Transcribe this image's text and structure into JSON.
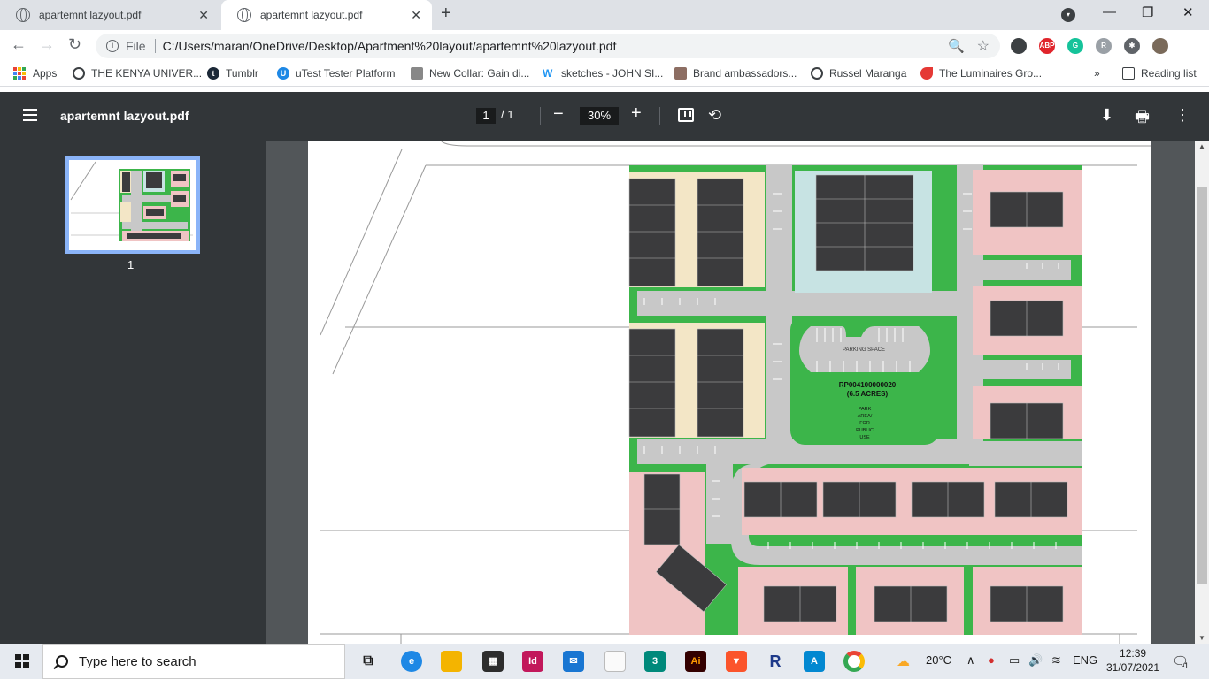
{
  "tabs": [
    {
      "title": "apartemnt lazyout.pdf",
      "active": false
    },
    {
      "title": "apartemnt lazyout.pdf",
      "active": true
    }
  ],
  "tab_close_glyph": "✕",
  "new_tab_glyph": "+",
  "window_controls": {
    "minimize": "—",
    "maximize": "❐",
    "close": "✕"
  },
  "toolbar": {
    "back_glyph": "←",
    "forward_glyph": "→",
    "reload_glyph": "↻",
    "file_label": "File",
    "url": "C:/Users/maran/OneDrive/Desktop/Apartment%20layout/apartemnt%20lazyout.pdf",
    "zoom_glyph": "🔍",
    "star_glyph": "☆"
  },
  "extensions": [
    {
      "name": "extension-icon",
      "label": "",
      "color": "#3c4043"
    },
    {
      "name": "adblock-icon",
      "label": "ABP",
      "color": "#e0242b"
    },
    {
      "name": "grammarly-icon",
      "label": "G",
      "color": "#15c39a"
    },
    {
      "name": "reader-extension-icon",
      "label": "R",
      "color": "#9aa0a6"
    },
    {
      "name": "puzzle-icon",
      "label": "✱",
      "color": "#5f6368"
    },
    {
      "name": "profile-avatar",
      "label": "",
      "color": "#7a6a5a"
    }
  ],
  "bookmarks": [
    {
      "label": "Apps",
      "icon": "apps-grid-icon",
      "color": "#ea4335"
    },
    {
      "label": "THE KENYA UNIVER...",
      "icon": "globe-icon",
      "color": "#3c4043"
    },
    {
      "label": "Tumblr",
      "icon": "tumblr-icon",
      "color": "#1b2837"
    },
    {
      "label": "uTest Tester Platform",
      "icon": "utest-icon",
      "color": "#1e88e5"
    },
    {
      "label": "New Collar: Gain di...",
      "icon": "newcollar-icon",
      "color": "#555555"
    },
    {
      "label": "sketches - JOHN SI...",
      "icon": "weebly-icon",
      "color": "#2196f3"
    },
    {
      "label": "Brand ambassadors...",
      "icon": "brand-icon",
      "color": "#8d6e63"
    },
    {
      "label": "Russel Maranga",
      "icon": "globe-icon",
      "color": "#3c4043"
    },
    {
      "label": "The Luminaires Gro...",
      "icon": "luminaires-icon",
      "color": "#e53935"
    }
  ],
  "bookmarks_overflow": "»",
  "reading_list": "Reading list",
  "pdf": {
    "title": "apartemnt lazyout.pdf",
    "page_current": "1",
    "page_total": "/  1",
    "zoom": "30%",
    "minus": "−",
    "plus": "+",
    "rotate_glyph": "⟲",
    "download_glyph": "⬇",
    "print_glyph": "🖶",
    "more_glyph": "⋮",
    "thumbnail_page": "1"
  },
  "plan": {
    "parking_label": "PARKING SPACE",
    "parcel_id": "RP004100000020",
    "acres": "(6.5 ACRES)",
    "park_lines": [
      "PARK",
      "AREA/",
      "FOR",
      "PUBLIC",
      "USE"
    ],
    "colors": {
      "grass": "#3cb54a",
      "road": "#c8c8c8",
      "building": "#3b3b3d",
      "pink_lot": "#f0c4c4",
      "beige_lot": "#f3e6c6",
      "blue_lot": "#c7e3e3"
    }
  },
  "taskbar": {
    "search_placeholder": "Type here to search",
    "weather": "20°C",
    "lang": "ENG",
    "time": "12:39",
    "date": "31/07/2021",
    "notifications": "1"
  }
}
